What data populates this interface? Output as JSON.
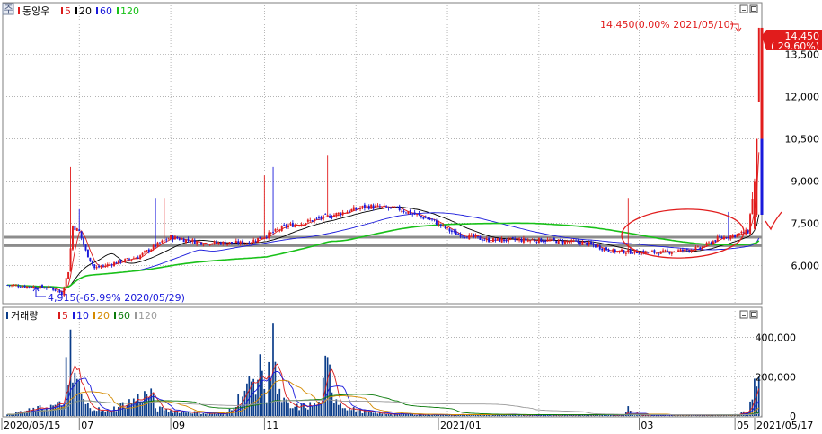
{
  "app": {
    "tab_icon_label": "주",
    "stock_name": "동양우",
    "price_ma_legend": [
      {
        "label": "5",
        "color": "#d81b1b"
      },
      {
        "label": "20",
        "color": "#000000"
      },
      {
        "label": "60",
        "color": "#1a1adb"
      },
      {
        "label": "120",
        "color": "#19c119"
      }
    ],
    "volume_title": "거래량",
    "volume_ma_legend": [
      {
        "label": "5",
        "color": "#d81b1b"
      },
      {
        "label": "10",
        "color": "#1a1adb"
      },
      {
        "label": "20",
        "color": "#d48a00"
      },
      {
        "label": "60",
        "color": "#0a7a0a"
      },
      {
        "label": "120",
        "color": "#9a9a9a"
      }
    ]
  },
  "annotations": {
    "high": "14,450(0.00% 2021/05/10)",
    "low": "4,915(-65.99% 2020/05/29)",
    "current_price": "14,450",
    "current_change": "( 29.60%)"
  },
  "colors": {
    "up": "#e11c1c",
    "down": "#1a1adb",
    "ma5": "#d81b1b",
    "ma20": "#000000",
    "ma60": "#1a1adb",
    "ma120": "#19c119",
    "vol_bar": "#0b3d8a",
    "grid": "#9a9a9a",
    "support_band": "#8c8c8c",
    "marker": "#e11c1c"
  },
  "chart_data": [
    {
      "type": "candlestick",
      "name": "price",
      "y_ticks": [
        "13,500",
        "12,000",
        "10,500",
        "9,000",
        "7,500",
        "6,000"
      ],
      "y_tick_values": [
        13500,
        12000,
        10500,
        9000,
        7500,
        6000
      ],
      "ylim": [
        4700,
        14800
      ],
      "x_tick_labels": [
        "2020/05/15",
        "07",
        "09",
        "11",
        "2021/01",
        "03",
        "05",
        "2021/05/17"
      ],
      "grid": true,
      "anchors": [
        {
          "i": 0,
          "v": 5300
        },
        {
          "i": 10,
          "v": 5250
        },
        {
          "i": 20,
          "v": 5200
        },
        {
          "i": 25,
          "v": 5000
        },
        {
          "i": 28,
          "v": 5800
        },
        {
          "i": 30,
          "v": 7400
        },
        {
          "i": 33,
          "v": 7200
        },
        {
          "i": 36,
          "v": 6500
        },
        {
          "i": 40,
          "v": 5900
        },
        {
          "i": 50,
          "v": 6100
        },
        {
          "i": 60,
          "v": 6300
        },
        {
          "i": 68,
          "v": 6700
        },
        {
          "i": 75,
          "v": 7000
        },
        {
          "i": 90,
          "v": 6800
        },
        {
          "i": 110,
          "v": 6800
        },
        {
          "i": 120,
          "v": 7100
        },
        {
          "i": 128,
          "v": 7400
        },
        {
          "i": 135,
          "v": 7500
        },
        {
          "i": 150,
          "v": 7800
        },
        {
          "i": 165,
          "v": 8100
        },
        {
          "i": 180,
          "v": 8000
        },
        {
          "i": 195,
          "v": 7600
        },
        {
          "i": 205,
          "v": 7150
        },
        {
          "i": 220,
          "v": 6900
        },
        {
          "i": 245,
          "v": 6900
        },
        {
          "i": 265,
          "v": 6800
        },
        {
          "i": 278,
          "v": 6500
        },
        {
          "i": 300,
          "v": 6450
        },
        {
          "i": 318,
          "v": 6600
        },
        {
          "i": 326,
          "v": 6950
        },
        {
          "i": 335,
          "v": 7100
        },
        {
          "i": 340,
          "v": 7200
        },
        {
          "i": 343,
          "v": 9000
        },
        {
          "i": 344,
          "v": 10500
        },
        {
          "i": 345,
          "v": 14450
        }
      ],
      "spikes": [
        {
          "i": 29,
          "high": 9500
        },
        {
          "i": 33,
          "high": 8000
        },
        {
          "i": 68,
          "high": 8400
        },
        {
          "i": 72,
          "high": 8400
        },
        {
          "i": 118,
          "high": 9200
        },
        {
          "i": 122,
          "high": 9500
        },
        {
          "i": 147,
          "high": 9900
        },
        {
          "i": 285,
          "high": 8400
        },
        {
          "i": 331,
          "high": 7900
        },
        {
          "i": 342,
          "high": 8600
        }
      ],
      "support_lines": [
        7000,
        6700
      ],
      "ma_windows": [
        5,
        20,
        60,
        120
      ]
    },
    {
      "type": "bar",
      "name": "volume",
      "y_ticks": [
        "400,000",
        "200,000",
        "0"
      ],
      "y_tick_values": [
        400000,
        200000,
        0
      ],
      "ylim": [
        0,
        480000
      ],
      "anchors": [
        {
          "i": 0,
          "v": 8000
        },
        {
          "i": 26,
          "v": 60000
        },
        {
          "i": 27,
          "v": 300000
        },
        {
          "i": 28,
          "v": 160000
        },
        {
          "i": 29,
          "v": 440000
        },
        {
          "i": 30,
          "v": 170000
        },
        {
          "i": 31,
          "v": 220000
        },
        {
          "i": 34,
          "v": 110000
        },
        {
          "i": 36,
          "v": 60000
        },
        {
          "i": 45,
          "v": 20000
        },
        {
          "i": 67,
          "v": 120000
        },
        {
          "i": 68,
          "v": 40000
        },
        {
          "i": 72,
          "v": 30000
        },
        {
          "i": 100,
          "v": 8000
        },
        {
          "i": 117,
          "v": 230000
        },
        {
          "i": 119,
          "v": 70000
        },
        {
          "i": 122,
          "v": 470000
        },
        {
          "i": 124,
          "v": 110000
        },
        {
          "i": 130,
          "v": 40000
        },
        {
          "i": 144,
          "v": 60000
        },
        {
          "i": 147,
          "v": 300000
        },
        {
          "i": 149,
          "v": 120000
        },
        {
          "i": 155,
          "v": 40000
        },
        {
          "i": 170,
          "v": 12000
        },
        {
          "i": 200,
          "v": 7000
        },
        {
          "i": 283,
          "v": 6000
        },
        {
          "i": 285,
          "v": 50000
        },
        {
          "i": 287,
          "v": 6000
        },
        {
          "i": 330,
          "v": 4000
        },
        {
          "i": 340,
          "v": 20000
        },
        {
          "i": 343,
          "v": 190000
        },
        {
          "i": 344,
          "v": 150000
        },
        {
          "i": 345,
          "v": 200000
        }
      ],
      "ma_windows": [
        5,
        10,
        20,
        60,
        120
      ]
    }
  ],
  "candle_count": 346
}
